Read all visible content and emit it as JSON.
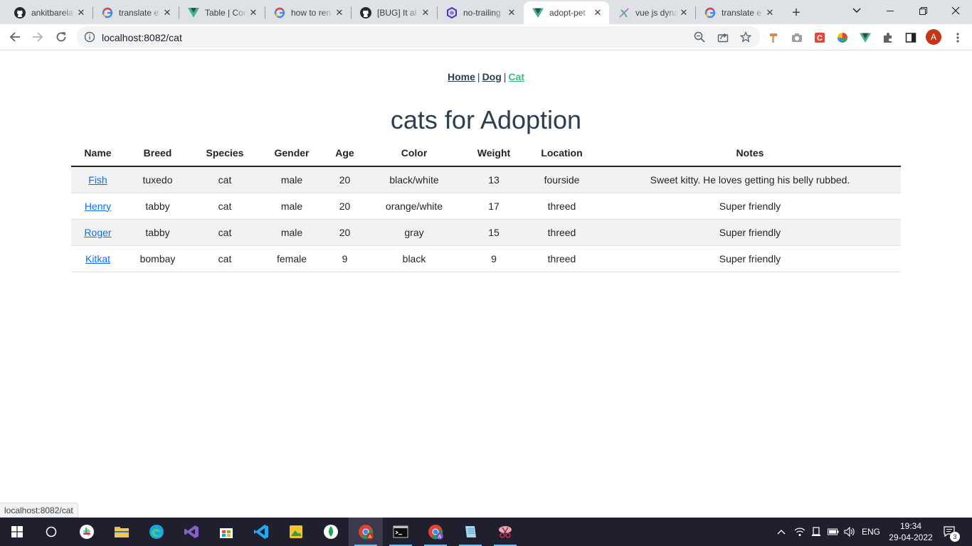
{
  "browser": {
    "tabs": [
      {
        "title": "ankitbarela",
        "icon": "github-icon"
      },
      {
        "title": "translate e",
        "icon": "google-icon"
      },
      {
        "title": "Table | Cor",
        "icon": "bootstrap-vue-icon"
      },
      {
        "title": "how to ren",
        "icon": "google-icon"
      },
      {
        "title": "[BUG] It al",
        "icon": "github-icon"
      },
      {
        "title": "no-trailing",
        "icon": "eslint-icon"
      },
      {
        "title": "adopt-pet",
        "icon": "vue-icon",
        "active": true
      },
      {
        "title": "vue js dyna",
        "icon": "sparkle-icon"
      },
      {
        "title": "translate e",
        "icon": "google-icon"
      }
    ],
    "url": "localhost:8082/cat",
    "profile_initial": "A",
    "status_url": "localhost:8082/cat"
  },
  "page": {
    "nav": [
      {
        "label": "Home",
        "active": false
      },
      {
        "label": "Dog",
        "active": false
      },
      {
        "label": "Cat",
        "active": true
      }
    ],
    "nav_separator": "|",
    "heading": "cats for Adoption",
    "table": {
      "columns": [
        "Name",
        "Breed",
        "Species",
        "Gender",
        "Age",
        "Color",
        "Weight",
        "Location",
        "Notes"
      ],
      "rows": [
        [
          "Fish",
          "tuxedo",
          "cat",
          "male",
          "20",
          "black/white",
          "13",
          "fourside",
          "Sweet kitty. He loves getting his belly rubbed."
        ],
        [
          "Henry",
          "tabby",
          "cat",
          "male",
          "20",
          "orange/white",
          "17",
          "threed",
          "Super friendly"
        ],
        [
          "Roger",
          "tabby",
          "cat",
          "male",
          "20",
          "gray",
          "15",
          "threed",
          "Super friendly"
        ],
        [
          "Kitkat",
          "bombay",
          "cat",
          "female",
          "9",
          "black",
          "9",
          "threed",
          "Super friendly"
        ]
      ]
    }
  },
  "taskbar": {
    "language": "ENG",
    "time": "19:34",
    "date": "29-04-2022",
    "notification_count": "3"
  },
  "colors": {
    "accent_link_active": "#42b983",
    "text": "#2c3e50",
    "table_link": "#0d6efd",
    "striped_row": "#f2f2f2"
  }
}
